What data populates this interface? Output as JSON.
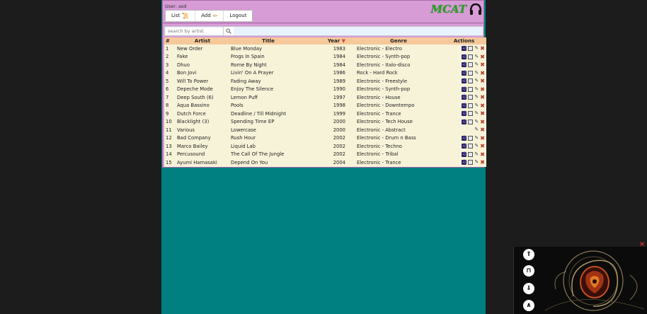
{
  "header": {
    "user_text": "User: asd",
    "logo": "MCAT",
    "nav": [
      {
        "label": "List",
        "icon": "scroll-icon"
      },
      {
        "label": "Add",
        "icon": "pencil-icon"
      },
      {
        "label": "Logout"
      }
    ]
  },
  "search": {
    "placeholder": "search by artist"
  },
  "table": {
    "headers": [
      "#",
      "Artist",
      "Title",
      "Year",
      "Genre",
      "Actions"
    ],
    "sort_indicator": "▼",
    "rows": [
      {
        "n": "1",
        "artist": "New Order",
        "title": "Blue Monday",
        "year": "1983",
        "genre": "Electronic - Electro",
        "has_media": true
      },
      {
        "n": "2",
        "artist": "Fake",
        "title": "Frogs In Spain",
        "year": "1984",
        "genre": "Electronic - Synth-pop",
        "has_media": true
      },
      {
        "n": "3",
        "artist": "Dhuo",
        "title": "Rome By Night",
        "year": "1984",
        "genre": "Electronic - Italo-disco",
        "has_media": true
      },
      {
        "n": "4",
        "artist": "Bon Jovi",
        "title": "Livin' On A Prayer",
        "year": "1986",
        "genre": "Rock - Hard Rock",
        "has_media": true
      },
      {
        "n": "5",
        "artist": "Will To Power",
        "title": "Fading Away",
        "year": "1989",
        "genre": "Electronic - Freestyle",
        "has_media": true
      },
      {
        "n": "6",
        "artist": "Depeche Mode",
        "title": "Enjoy The Silence",
        "year": "1990",
        "genre": "Electronic - Synth-pop",
        "has_media": true
      },
      {
        "n": "7",
        "artist": "Deep South (6)",
        "title": "Lemon Puff",
        "year": "1997",
        "genre": "Electronic - House",
        "has_media": true
      },
      {
        "n": "8",
        "artist": "Aqua Bassino",
        "title": "Pools",
        "year": "1998",
        "genre": "Electronic - Downtempo",
        "has_media": true
      },
      {
        "n": "9",
        "artist": "Dutch Force",
        "title": "Deadline / Till Midnight",
        "year": "1999",
        "genre": "Electronic - Trance",
        "has_media": true
      },
      {
        "n": "10",
        "artist": "Blacklight (3)",
        "title": "Spending Time EP",
        "year": "2000",
        "genre": "Electronic - Tech House",
        "has_media": true
      },
      {
        "n": "11",
        "artist": "Various",
        "title": "Lowercase",
        "year": "2000",
        "genre": "Electronic - Abstract",
        "has_media": false
      },
      {
        "n": "12",
        "artist": "Bad Company",
        "title": "Rush Hour",
        "year": "2002",
        "genre": "Electronic - Drum n Bass",
        "has_media": true
      },
      {
        "n": "13",
        "artist": "Marco Bailey",
        "title": "Liquid Lab",
        "year": "2002",
        "genre": "Electronic - Techno",
        "has_media": true
      },
      {
        "n": "14",
        "artist": "Percusound",
        "title": "The Call Of The Jungle",
        "year": "2002",
        "genre": "Electronic - Tribal",
        "has_media": true
      },
      {
        "n": "15",
        "artist": "Ayumi Hamasaki",
        "title": "Depend On You",
        "year": "2004",
        "genre": "Electronic - Trance",
        "has_media": true
      }
    ]
  },
  "player": {
    "close": "×",
    "buttons": [
      "prev-icon",
      "pause-icon",
      "next-icon",
      "collapse-icon"
    ],
    "button_glyphs": [
      "⇑",
      "⊓",
      "⇓",
      "∧"
    ]
  }
}
